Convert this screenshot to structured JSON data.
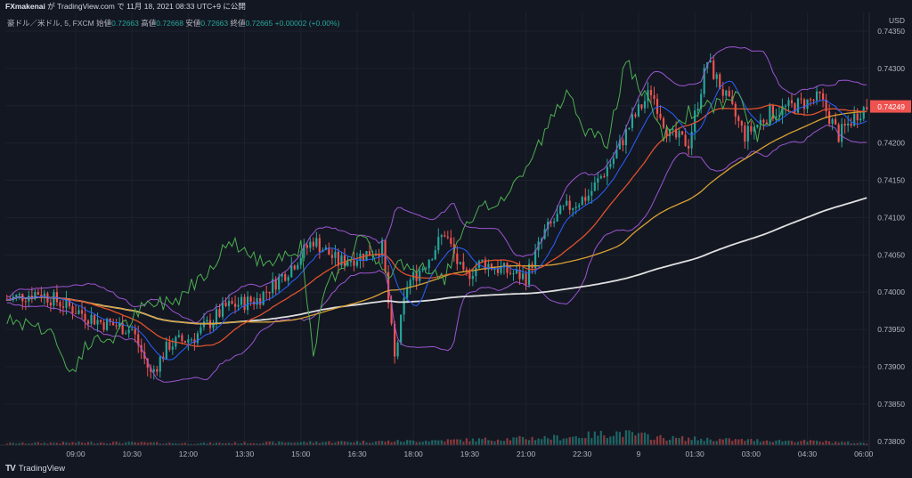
{
  "header": {
    "author": "FXmakenai",
    "publish_text": "が TradingView.com で 11月 18, 2021 08:33 UTC+9 に公開"
  },
  "ohlc": {
    "symbol": "豪ドル／米ドル, 5, FXCM",
    "open_label": "始値",
    "open": "0.72663",
    "high_label": "高値",
    "high": "0.72668",
    "low_label": "安値",
    "low": "0.72663",
    "close_label": "終値",
    "close": "0.72665",
    "change": "+0.00002 (+0.00%)"
  },
  "colors": {
    "background": "#131722",
    "up": "#26a69a",
    "down": "#ef5350",
    "grid": "#1e222d"
  },
  "footer": {
    "brand": "TradingView"
  },
  "chart_data": {
    "type": "candlestick",
    "currency": "USD",
    "last_price_label": "0.74249",
    "ylim": [
      0.73795,
      0.74375
    ],
    "y_ticks": [
      0.7435,
      0.743,
      0.7425,
      0.742,
      0.7415,
      0.741,
      0.7405,
      0.74,
      0.7395,
      0.739,
      0.7385,
      0.738
    ],
    "y_tick_labels": [
      "0.74350",
      "0.74300",
      "0.74250",
      "0.74200",
      "0.74150",
      "0.74100",
      "0.74050",
      "0.74000",
      "0.73950",
      "0.73900",
      "0.73850",
      "0.73800"
    ],
    "x_tick_labels": [
      "09:00",
      "10:30",
      "12:00",
      "13:30",
      "15:00",
      "16:30",
      "18:00",
      "19:30",
      "21:00",
      "22:30",
      "9",
      "01:30",
      "03:00",
      "04:30",
      "06:00"
    ],
    "bars_total": 276,
    "x_tick_bar_index": [
      22,
      40,
      58,
      76,
      94,
      112,
      130,
      148,
      166,
      184,
      202,
      220,
      238,
      256,
      274
    ],
    "price_path": [
      [
        0,
        0.7399
      ],
      [
        10,
        0.74
      ],
      [
        20,
        0.7398
      ],
      [
        30,
        0.7396
      ],
      [
        40,
        0.7395
      ],
      [
        46,
        0.7389
      ],
      [
        52,
        0.7393
      ],
      [
        60,
        0.7394
      ],
      [
        70,
        0.7398
      ],
      [
        80,
        0.7399
      ],
      [
        90,
        0.7403
      ],
      [
        98,
        0.7407
      ],
      [
        106,
        0.7404
      ],
      [
        114,
        0.7405
      ],
      [
        120,
        0.7406
      ],
      [
        124,
        0.7391
      ],
      [
        128,
        0.7401
      ],
      [
        134,
        0.7404
      ],
      [
        140,
        0.7408
      ],
      [
        146,
        0.7402
      ],
      [
        152,
        0.7404
      ],
      [
        158,
        0.7403
      ],
      [
        166,
        0.7402
      ],
      [
        172,
        0.7408
      ],
      [
        178,
        0.7411
      ],
      [
        186,
        0.7413
      ],
      [
        194,
        0.7418
      ],
      [
        200,
        0.7423
      ],
      [
        206,
        0.7427
      ],
      [
        212,
        0.7421
      ],
      [
        218,
        0.742
      ],
      [
        224,
        0.7431
      ],
      [
        230,
        0.7426
      ],
      [
        236,
        0.7421
      ],
      [
        244,
        0.7424
      ],
      [
        252,
        0.7425
      ],
      [
        260,
        0.7426
      ],
      [
        266,
        0.7421
      ],
      [
        272,
        0.7424
      ],
      [
        275,
        0.74249
      ]
    ],
    "volume_bars": [
      [
        0,
        2
      ],
      [
        30,
        3
      ],
      [
        60,
        2
      ],
      [
        90,
        3
      ],
      [
        120,
        4
      ],
      [
        150,
        6
      ],
      [
        180,
        9
      ],
      [
        195,
        14
      ],
      [
        210,
        8
      ],
      [
        230,
        6
      ],
      [
        260,
        4
      ],
      [
        275,
        2
      ]
    ]
  }
}
